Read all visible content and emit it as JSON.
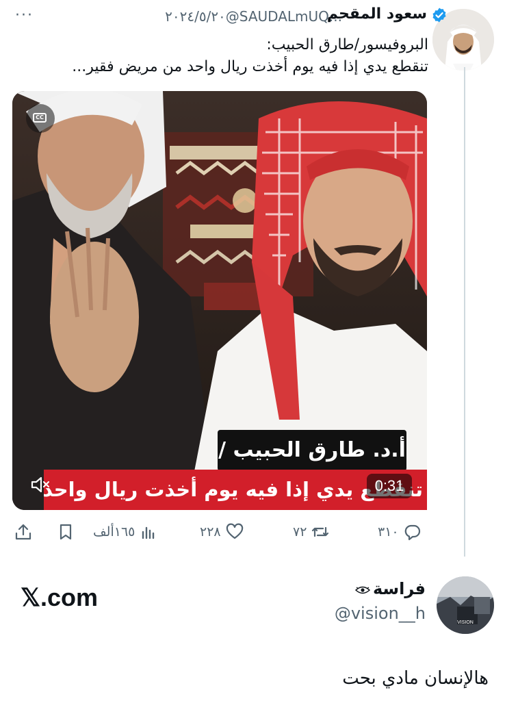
{
  "tweet": {
    "author_name": "سعود المقحم",
    "handle": "@SAUDALmUQ...",
    "date": "٢٠٢٤/٥/٢٠",
    "more_label": "···",
    "text_line1": "البروفيسور/طارق الحبيب:",
    "text_line2": "تنقطع يدي إذا فيه يوم أخذت ريال واحد من مريض فقير..."
  },
  "video": {
    "cc_label": "CC",
    "name_overlay": "أ.د. طارق الحبيب /",
    "caption_overlay": "تنقطع يدي إذا فيه يوم أخذت ريال واحد",
    "time": "0:31"
  },
  "actions": {
    "replies": "٣١٠",
    "retweets": "٧٢",
    "likes": "٢٢٨",
    "views": "١٦٥ألف"
  },
  "reply": {
    "watermark": "𝕏.com",
    "author_name": "فراسة",
    "handle": "@vision__h",
    "avatar_label": "VISION",
    "text": "هالإنسان مادي بحت"
  },
  "colors": {
    "verified_blue": "#1d9bf0",
    "muted_text": "#536471",
    "thread_line": "#cfd9de",
    "caption_red": "#d21f2a"
  }
}
